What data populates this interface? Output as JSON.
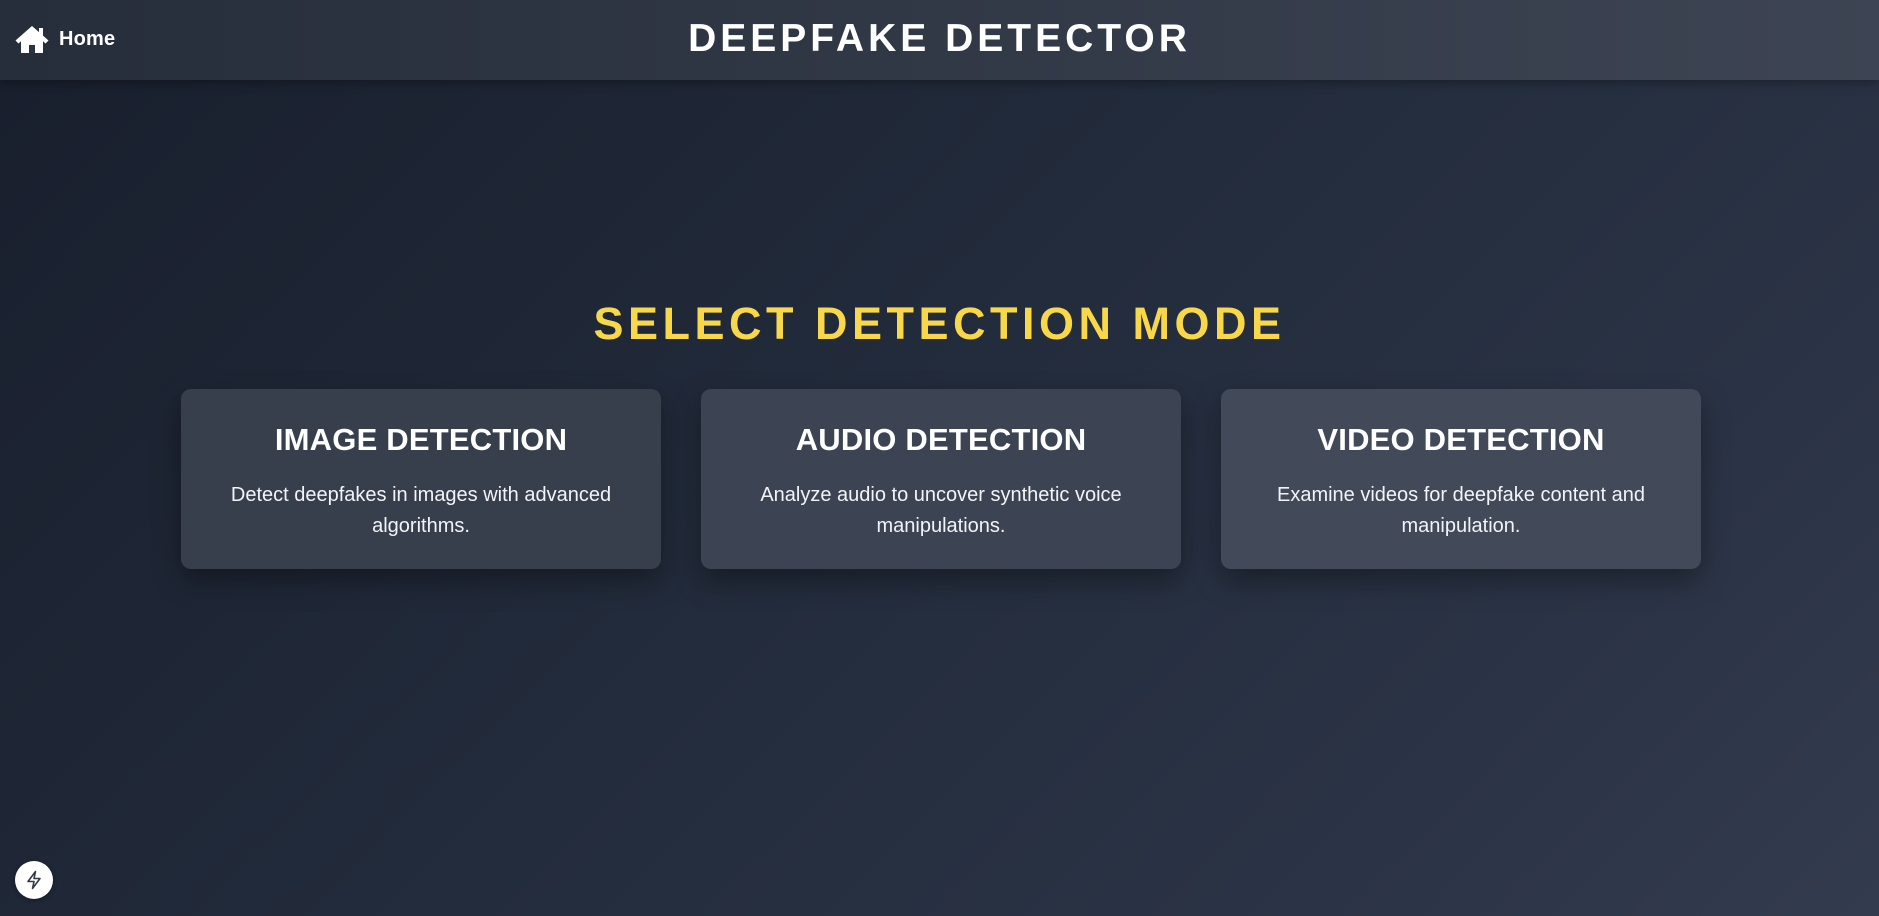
{
  "header": {
    "home_label": "Home",
    "home_icon": "home-icon",
    "title": "DEEPFAKE DETECTOR"
  },
  "main": {
    "section_title": "SELECT DETECTION MODE",
    "cards": [
      {
        "title": "IMAGE DETECTION",
        "description": "Detect deepfakes in images with advanced algorithms."
      },
      {
        "title": "AUDIO DETECTION",
        "description": "Analyze audio to uncover synthetic voice manipulations."
      },
      {
        "title": "VIDEO DETECTION",
        "description": "Examine videos for deepfake content and manipulation."
      }
    ]
  },
  "floating_button": {
    "icon": "lightning-bolt-icon"
  },
  "colors": {
    "accent": "#f8d74a",
    "card_background": "#3a4250",
    "header_background": "#313846",
    "text": "#ffffff"
  }
}
